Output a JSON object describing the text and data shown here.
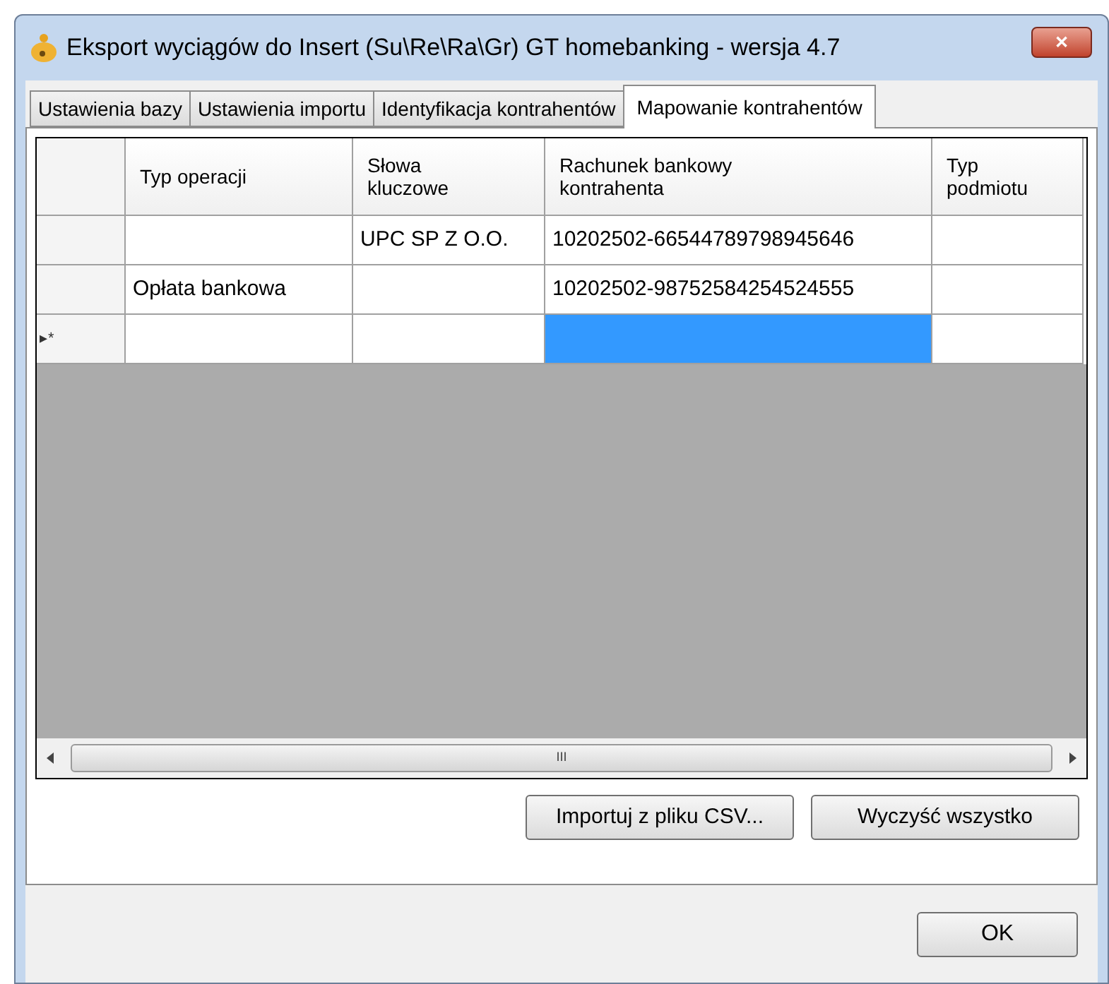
{
  "window": {
    "title": "Eksport wyciągów do Insert (Su\\Re\\Ra\\Gr) GT homebanking - wersja 4.7",
    "close": "✕"
  },
  "tabs": [
    {
      "label": "Ustawienia bazy",
      "selected": false
    },
    {
      "label": "Ustawienia importu",
      "selected": false
    },
    {
      "label": "Identyfikacja kontrahentów",
      "selected": false
    },
    {
      "label": "Mapowanie kontrahentów",
      "selected": true
    }
  ],
  "table": {
    "columns": [
      "Typ operacji",
      "Słowa\nkluczowe",
      "Rachunek bankowy\nkontrahenta",
      "Typ\npodmiotu"
    ],
    "rows": [
      {
        "cells": [
          {
            "selected": false
          },
          {
            "text": "UPC SP Z O.O.",
            "selected": false
          },
          {
            "text": "10202502-66544789798945646",
            "selected": false
          },
          {
            "selected": false
          }
        ]
      },
      {
        "cells": [
          {
            "text": "Opłata bankowa",
            "selected": false
          },
          {
            "selected": false
          },
          {
            "text": "10202502-98752584254524555",
            "selected": false
          },
          {
            "selected": false
          }
        ]
      },
      {
        "marker": "▸*",
        "cells": [
          {
            "selected": false
          },
          {
            "selected": false
          },
          {
            "selected": true
          },
          {
            "selected": false
          }
        ]
      }
    ],
    "scroll_grip": "III"
  },
  "buttons": [
    "Importuj z pliku CSV...",
    "Wyczyść wszystko"
  ],
  "footer_button": "OK"
}
